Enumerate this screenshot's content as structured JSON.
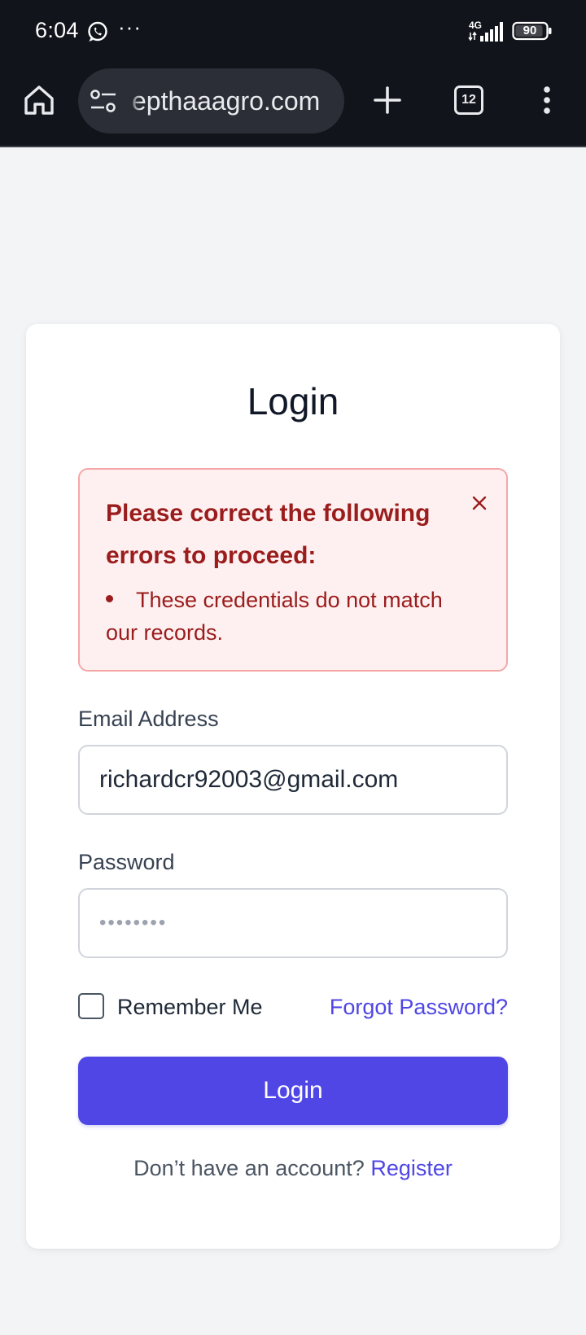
{
  "status_bar": {
    "time": "6:04",
    "network": "4G",
    "battery": "90",
    "icons": [
      "whatsapp-icon",
      "more-dots-icon",
      "signal-icon",
      "battery-icon"
    ]
  },
  "browser": {
    "url": "epthaaagro.com",
    "tab_count": "12",
    "icons": [
      "home-icon",
      "site-settings-icon",
      "new-tab-icon",
      "tab-switcher-icon",
      "menu-icon"
    ]
  },
  "login": {
    "title": "Login",
    "error": {
      "heading": "Please correct the following errors to proceed:",
      "items": [
        "These credentials do not match our records."
      ]
    },
    "email_label": "Email Address",
    "email_value": "richardcr92003@gmail.com",
    "password_label": "Password",
    "password_value": "••••••••",
    "remember_label": "Remember Me",
    "remember_checked": false,
    "forgot_label": "Forgot Password?",
    "submit_label": "Login",
    "register_prompt": "Don’t have an account?",
    "register_link": "Register"
  },
  "colors": {
    "accent": "#4f46e5",
    "error_text": "#9b1c1c",
    "error_bg": "#fef0f0",
    "error_border": "#f5a7a7",
    "page_bg": "#f3f4f6",
    "browser_bar": "#12141b"
  }
}
